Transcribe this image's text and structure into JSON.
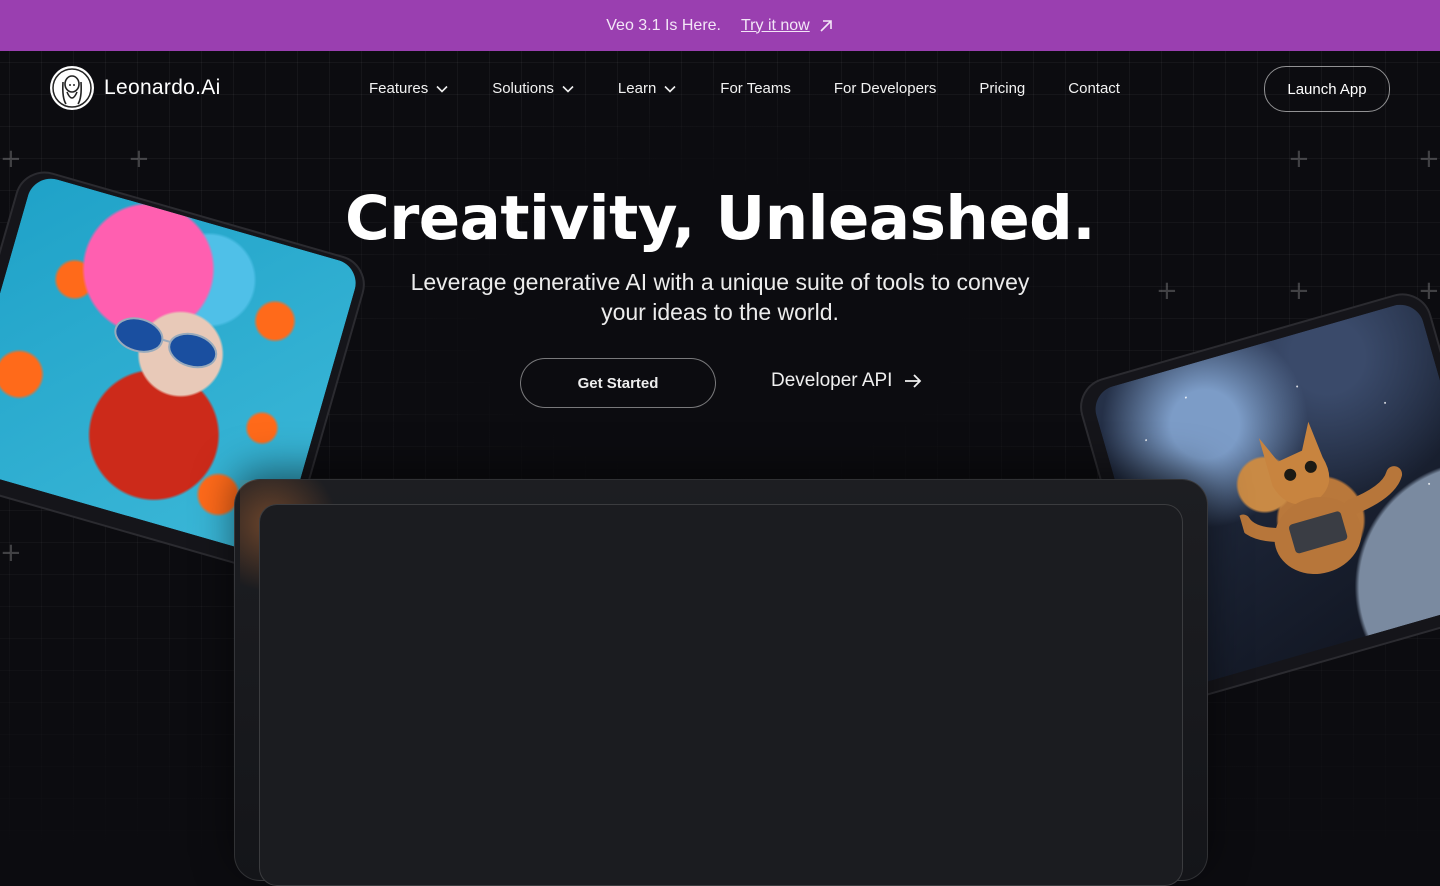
{
  "announcement": {
    "message": "Veo 3.1 Is Here.",
    "link_label": "Try it now",
    "background": "#9a3fb0"
  },
  "nav": {
    "brand": "Leonardo.Ai",
    "items": [
      {
        "label": "Features",
        "dropdown": true
      },
      {
        "label": "Solutions",
        "dropdown": true
      },
      {
        "label": "Learn",
        "dropdown": true
      },
      {
        "label": "For Teams",
        "dropdown": false
      },
      {
        "label": "For Developers",
        "dropdown": false
      },
      {
        "label": "Pricing",
        "dropdown": false
      },
      {
        "label": "Contact",
        "dropdown": false
      }
    ],
    "launch_label": "Launch App"
  },
  "hero": {
    "title": "Creativity, Unleashed.",
    "subtitle": "Leverage generative AI with a unique suite of tools to convey your ideas to the world.",
    "primary_cta": "Get Started",
    "secondary_cta": "Developer API"
  },
  "images": {
    "left": "woman-with-pink-blue-hair-and-sunglasses-image",
    "right": "cat-in-space-image"
  },
  "colors": {
    "page_background": "#0c0c10",
    "accent": "#9a3fb0"
  }
}
